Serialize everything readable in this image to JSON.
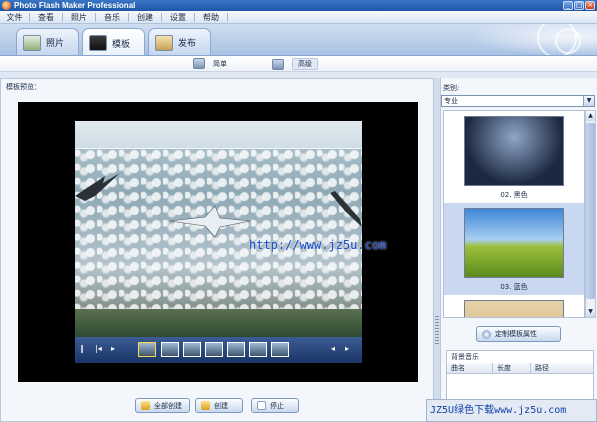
{
  "window": {
    "title": "Photo Flash Maker Professional"
  },
  "menu": [
    "文件",
    "查看",
    "照片",
    "音乐",
    "创建",
    "设置",
    "帮助"
  ],
  "tabs": [
    {
      "label": "照片",
      "icon": "photo-icon"
    },
    {
      "label": "模板",
      "icon": "film-icon"
    },
    {
      "label": "发布",
      "icon": "publish-icon"
    }
  ],
  "subnav": {
    "simple": "简单",
    "advanced": "高级"
  },
  "left": {
    "preview_label": "模板预览："
  },
  "watermark_url": "http://www.jz5u.com",
  "actions": {
    "create_all": "全部创建",
    "create": "创建",
    "stop": "停止"
  },
  "right": {
    "category_label": "类别:",
    "category_value": "专业",
    "templates": [
      {
        "caption": "02. 黑色",
        "icon": "template-black-thumbnail"
      },
      {
        "caption": "03. 蓝色",
        "icon": "template-blue-thumbnail"
      }
    ],
    "custom_button": "定制模板属性",
    "bg_music_label": "背景音乐",
    "music_columns": [
      "曲名",
      "长度",
      "路径"
    ]
  },
  "site_watermark": "JZ5U绿色下载www.jz5u.com"
}
